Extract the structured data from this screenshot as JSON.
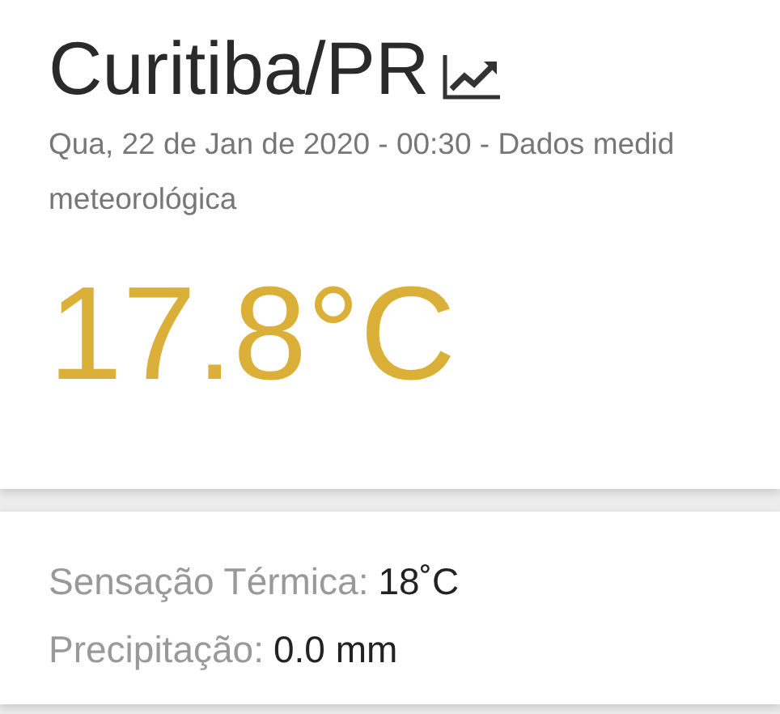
{
  "city": "Curitiba/PR",
  "subtitle_lines": [
    "Qua, 22 de Jan de 2020 - 00:30 - Dados medid",
    "meteorológica"
  ],
  "temperature": "17.8°C",
  "details": [
    {
      "label": "Sensação Térmica:",
      "value": "18˚C"
    },
    {
      "label": "Precipitação:",
      "value": "0.0 mm"
    }
  ]
}
